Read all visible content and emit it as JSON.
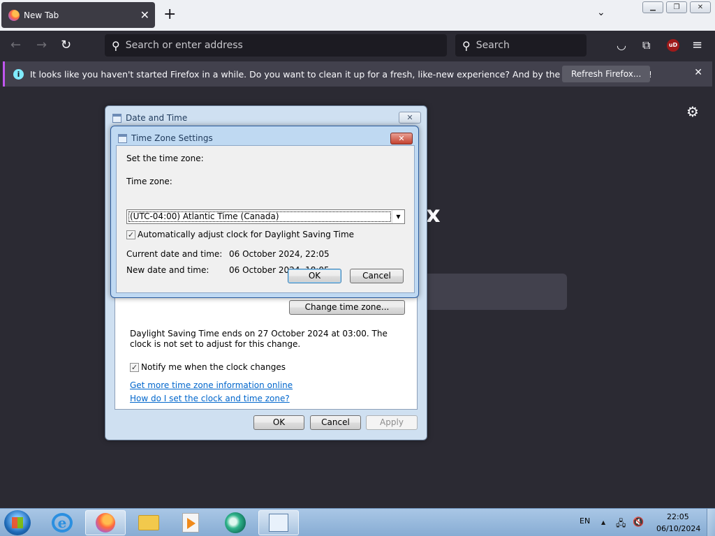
{
  "browser": {
    "tab_title": "New Tab",
    "close_tab": "✕",
    "new_tab": "+",
    "tab_list": "⌄",
    "urlbar_placeholder": "Search or enter address",
    "searchbar_placeholder": "Search",
    "notification": {
      "message": "It looks like you haven't started Firefox in a while. Do you want to clean it up for a fresh, like-new experience? And by the way, welcome back!",
      "button": "Refresh Firefox...",
      "close": "✕"
    },
    "background_letter": "x"
  },
  "outer_dialog": {
    "title": "Date and Time",
    "close": "✕",
    "change_tz_button": "Change time zone...",
    "dst_notice": "Daylight Saving Time ends on 27 October 2024 at 03:00. The clock is not set to adjust for this change.",
    "notify_label": "Notify me when the clock changes",
    "notify_checked": "✓",
    "link_more_info": "Get more time zone information online",
    "link_how_to": "How do I set the clock and time zone?",
    "ok": "OK",
    "cancel": "Cancel",
    "apply": "Apply"
  },
  "inner_dialog": {
    "title": "Time Zone Settings",
    "close": "✕",
    "instruction": "Set the time zone:",
    "tz_label": "Time zone:",
    "tz_value": "(UTC-04:00) Atlantic Time (Canada)",
    "tz_arrow": "▼",
    "dst_label": "Automatically adjust clock for Daylight Saving Time",
    "dst_checked": "✓",
    "current_label": "Current date and time:",
    "current_value": "06 October 2024, 22:05",
    "new_label": "New date and time:",
    "new_value": "06 October 2024, 18:05",
    "ok": "OK",
    "cancel": "Cancel"
  },
  "taskbar": {
    "language": "EN",
    "time": "22:05",
    "date": "06/10/2024",
    "tray_up": "▲",
    "tray_network": "🖧",
    "tray_volume": "🔇"
  }
}
